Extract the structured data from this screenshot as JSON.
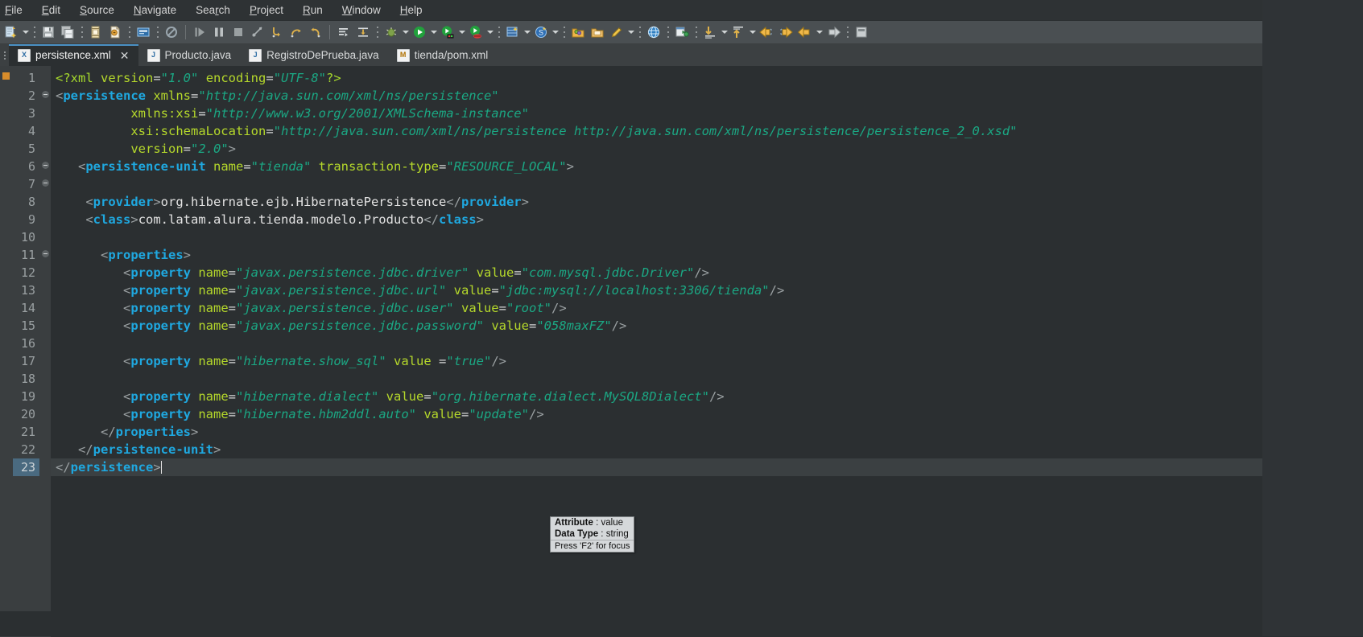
{
  "window": {
    "app": "Eclipse IDE"
  },
  "menubar": {
    "items": [
      {
        "label": "File",
        "mnemonic_index": 0
      },
      {
        "label": "Edit",
        "mnemonic_index": 0
      },
      {
        "label": "Source",
        "mnemonic_index": 0
      },
      {
        "label": "Navigate",
        "mnemonic_index": 0
      },
      {
        "label": "Search",
        "mnemonic_index": 3
      },
      {
        "label": "Project",
        "mnemonic_index": 0
      },
      {
        "label": "Run",
        "mnemonic_index": 0
      },
      {
        "label": "Window",
        "mnemonic_index": 0
      },
      {
        "label": "Help",
        "mnemonic_index": 0
      }
    ]
  },
  "toolbar": {
    "groups": [
      [
        "new-wizard-icon",
        "new-wizard-dropdown"
      ],
      [
        "save-icon",
        "save-all-icon"
      ],
      [
        "new-java-package-icon",
        "new-java-class-icon"
      ],
      [
        "open-task-icon"
      ],
      [
        "skip-all-breakpoints-icon"
      ],
      [
        "resume-icon",
        "suspend-icon",
        "terminate-icon",
        "disconnect-icon",
        "step-into-icon",
        "step-over-icon",
        "step-return-icon"
      ],
      [
        "use-step-filters-icon",
        "drop-to-frame-icon"
      ],
      [
        "debug-icon",
        "debug-dropdown",
        "run-icon",
        "run-dropdown",
        "run-as-server-icon",
        "run-as-server-dropdown",
        "coverage-icon",
        "coverage-dropdown"
      ],
      [
        "new-server-icon",
        "new-server-dropdown",
        "search-icon",
        "search-dropdown"
      ],
      [
        "open-type-icon",
        "open-task-folder-icon",
        "toggle-mark-occurrences-icon",
        "mark-dropdown"
      ],
      [
        "open-web-browser-icon"
      ],
      [
        "open-perspective-icon"
      ],
      [
        "previous-annotation-icon",
        "previous-annotation-dropdown"
      ],
      [
        "next-annotation-icon",
        "next-annotation-dropdown"
      ],
      [
        "back-to-icon",
        "forward-to-icon"
      ],
      [
        "back-navigation-icon",
        "back-navigation-dropdown",
        "forward-navigation-icon"
      ],
      [
        "pin-editor-icon"
      ]
    ]
  },
  "tabs": [
    {
      "label": "persistence.xml",
      "icon": "xml-file-icon",
      "icon_letter": "X",
      "icon_kind": "x",
      "active": true,
      "closeable": true
    },
    {
      "label": "Producto.java",
      "icon": "java-file-icon",
      "icon_letter": "J",
      "icon_kind": "j",
      "active": false,
      "closeable": false
    },
    {
      "label": "RegistroDePrueba.java",
      "icon": "java-file-icon",
      "icon_letter": "J",
      "icon_kind": "j",
      "active": false,
      "closeable": false
    },
    {
      "label": "tienda/pom.xml",
      "icon": "maven-file-icon",
      "icon_letter": "M",
      "icon_kind": "m",
      "active": false,
      "closeable": false
    }
  ],
  "editor": {
    "file": "persistence.xml",
    "current_line": 23,
    "total_lines": 23,
    "lines": [
      {
        "n": 1,
        "fold": false,
        "tokens": [
          {
            "t": "decl",
            "v": "<?xml "
          },
          {
            "t": "attr",
            "v": "version"
          },
          {
            "t": "eq",
            "v": "="
          },
          {
            "t": "val",
            "v": "\"1.0\""
          },
          {
            "t": "txt",
            "v": " "
          },
          {
            "t": "attr",
            "v": "encoding"
          },
          {
            "t": "eq",
            "v": "="
          },
          {
            "t": "val",
            "v": "\"UTF-8\""
          },
          {
            "t": "decl",
            "v": "?>"
          }
        ]
      },
      {
        "n": 2,
        "fold": true,
        "tokens": [
          {
            "t": "brack",
            "v": "<"
          },
          {
            "t": "tag",
            "v": "persistence"
          },
          {
            "t": "txt",
            "v": " "
          },
          {
            "t": "attr",
            "v": "xmlns"
          },
          {
            "t": "eq",
            "v": "="
          },
          {
            "t": "val",
            "v": "\"http://java.sun.com/xml/ns/persistence\""
          }
        ]
      },
      {
        "n": 3,
        "fold": false,
        "tokens": [
          {
            "t": "txt",
            "v": "          "
          },
          {
            "t": "attr",
            "v": "xmlns:xsi"
          },
          {
            "t": "eq",
            "v": "="
          },
          {
            "t": "val",
            "v": "\"http://www.w3.org/2001/XMLSchema-instance\""
          }
        ]
      },
      {
        "n": 4,
        "fold": false,
        "tokens": [
          {
            "t": "txt",
            "v": "          "
          },
          {
            "t": "attr",
            "v": "xsi:schemaLocation"
          },
          {
            "t": "eq",
            "v": "="
          },
          {
            "t": "val",
            "v": "\"http://java.sun.com/xml/ns/persistence http://java.sun.com/xml/ns/persistence/persistence_2_0.xsd\""
          }
        ]
      },
      {
        "n": 5,
        "fold": false,
        "tokens": [
          {
            "t": "txt",
            "v": "          "
          },
          {
            "t": "attr",
            "v": "version"
          },
          {
            "t": "eq",
            "v": "="
          },
          {
            "t": "val",
            "v": "\"2.0\""
          },
          {
            "t": "brack",
            "v": ">"
          }
        ]
      },
      {
        "n": 6,
        "fold": true,
        "tokens": [
          {
            "t": "txt",
            "v": "   "
          },
          {
            "t": "brack",
            "v": "<"
          },
          {
            "t": "tag",
            "v": "persistence-unit"
          },
          {
            "t": "txt",
            "v": " "
          },
          {
            "t": "attr",
            "v": "name"
          },
          {
            "t": "eq",
            "v": "="
          },
          {
            "t": "val",
            "v": "\"tienda\""
          },
          {
            "t": "txt",
            "v": " "
          },
          {
            "t": "attr",
            "v": "transaction-type"
          },
          {
            "t": "eq",
            "v": "="
          },
          {
            "t": "val",
            "v": "\"RESOURCE_LOCAL\""
          },
          {
            "t": "brack",
            "v": ">"
          }
        ]
      },
      {
        "n": 7,
        "fold": true,
        "tokens": []
      },
      {
        "n": 8,
        "fold": false,
        "tokens": [
          {
            "t": "txt",
            "v": "    "
          },
          {
            "t": "brack",
            "v": "<"
          },
          {
            "t": "tag",
            "v": "provider"
          },
          {
            "t": "brack",
            "v": ">"
          },
          {
            "t": "txt",
            "v": "org.hibernate.ejb.HibernatePersistence"
          },
          {
            "t": "brack",
            "v": "</"
          },
          {
            "t": "tag",
            "v": "provider"
          },
          {
            "t": "brack",
            "v": ">"
          }
        ]
      },
      {
        "n": 9,
        "fold": false,
        "tokens": [
          {
            "t": "txt",
            "v": "    "
          },
          {
            "t": "brack",
            "v": "<"
          },
          {
            "t": "tag",
            "v": "class"
          },
          {
            "t": "brack",
            "v": ">"
          },
          {
            "t": "txt",
            "v": "com.latam.alura.tienda.modelo.Producto"
          },
          {
            "t": "brack",
            "v": "</"
          },
          {
            "t": "tag",
            "v": "class"
          },
          {
            "t": "brack",
            "v": ">"
          }
        ]
      },
      {
        "n": 10,
        "fold": false,
        "tokens": []
      },
      {
        "n": 11,
        "fold": true,
        "tokens": [
          {
            "t": "txt",
            "v": "      "
          },
          {
            "t": "brack",
            "v": "<"
          },
          {
            "t": "tag",
            "v": "properties"
          },
          {
            "t": "brack",
            "v": ">"
          }
        ]
      },
      {
        "n": 12,
        "fold": false,
        "tokens": [
          {
            "t": "txt",
            "v": "         "
          },
          {
            "t": "brack",
            "v": "<"
          },
          {
            "t": "tag",
            "v": "property"
          },
          {
            "t": "txt",
            "v": " "
          },
          {
            "t": "attr",
            "v": "name"
          },
          {
            "t": "eq",
            "v": "="
          },
          {
            "t": "val",
            "v": "\"javax.persistence.jdbc.driver\""
          },
          {
            "t": "txt",
            "v": " "
          },
          {
            "t": "attr",
            "v": "value"
          },
          {
            "t": "eq",
            "v": "="
          },
          {
            "t": "val",
            "v": "\"com.mysql.jdbc.Driver\""
          },
          {
            "t": "brack",
            "v": "/>"
          }
        ]
      },
      {
        "n": 13,
        "fold": false,
        "tokens": [
          {
            "t": "txt",
            "v": "         "
          },
          {
            "t": "brack",
            "v": "<"
          },
          {
            "t": "tag",
            "v": "property"
          },
          {
            "t": "txt",
            "v": " "
          },
          {
            "t": "attr",
            "v": "name"
          },
          {
            "t": "eq",
            "v": "="
          },
          {
            "t": "val",
            "v": "\"javax.persistence.jdbc.url\""
          },
          {
            "t": "txt",
            "v": " "
          },
          {
            "t": "attr",
            "v": "value"
          },
          {
            "t": "eq",
            "v": "="
          },
          {
            "t": "val",
            "v": "\"jdbc:mysql://localhost:3306/tienda\""
          },
          {
            "t": "brack",
            "v": "/>"
          }
        ]
      },
      {
        "n": 14,
        "fold": false,
        "tokens": [
          {
            "t": "txt",
            "v": "         "
          },
          {
            "t": "brack",
            "v": "<"
          },
          {
            "t": "tag",
            "v": "property"
          },
          {
            "t": "txt",
            "v": " "
          },
          {
            "t": "attr",
            "v": "name"
          },
          {
            "t": "eq",
            "v": "="
          },
          {
            "t": "val",
            "v": "\"javax.persistence.jdbc.user\""
          },
          {
            "t": "txt",
            "v": " "
          },
          {
            "t": "attr",
            "v": "value"
          },
          {
            "t": "eq",
            "v": "="
          },
          {
            "t": "val",
            "v": "\"root\""
          },
          {
            "t": "brack",
            "v": "/>"
          }
        ]
      },
      {
        "n": 15,
        "fold": false,
        "tokens": [
          {
            "t": "txt",
            "v": "         "
          },
          {
            "t": "brack",
            "v": "<"
          },
          {
            "t": "tag",
            "v": "property"
          },
          {
            "t": "txt",
            "v": " "
          },
          {
            "t": "attr",
            "v": "name"
          },
          {
            "t": "eq",
            "v": "="
          },
          {
            "t": "val",
            "v": "\"javax.persistence.jdbc.password\""
          },
          {
            "t": "txt",
            "v": " "
          },
          {
            "t": "attr",
            "v": "value"
          },
          {
            "t": "eq",
            "v": "="
          },
          {
            "t": "val",
            "v": "\"058maxFZ\""
          },
          {
            "t": "brack",
            "v": "/>"
          }
        ]
      },
      {
        "n": 16,
        "fold": false,
        "tokens": []
      },
      {
        "n": 17,
        "fold": false,
        "tokens": [
          {
            "t": "txt",
            "v": "         "
          },
          {
            "t": "brack",
            "v": "<"
          },
          {
            "t": "tag",
            "v": "property"
          },
          {
            "t": "txt",
            "v": " "
          },
          {
            "t": "attr",
            "v": "name"
          },
          {
            "t": "eq",
            "v": "="
          },
          {
            "t": "val",
            "v": "\"hibernate.show_sql\""
          },
          {
            "t": "txt",
            "v": " "
          },
          {
            "t": "attr",
            "v": "value "
          },
          {
            "t": "eq",
            "v": "="
          },
          {
            "t": "val",
            "v": "\"true\""
          },
          {
            "t": "brack",
            "v": "/>"
          }
        ]
      },
      {
        "n": 18,
        "fold": false,
        "tokens": []
      },
      {
        "n": 19,
        "fold": false,
        "tokens": [
          {
            "t": "txt",
            "v": "         "
          },
          {
            "t": "brack",
            "v": "<"
          },
          {
            "t": "tag",
            "v": "property"
          },
          {
            "t": "txt",
            "v": " "
          },
          {
            "t": "attr",
            "v": "name"
          },
          {
            "t": "eq",
            "v": "="
          },
          {
            "t": "val",
            "v": "\"hibernate.dialect\""
          },
          {
            "t": "txt",
            "v": " "
          },
          {
            "t": "attr",
            "v": "value"
          },
          {
            "t": "eq",
            "v": "="
          },
          {
            "t": "val",
            "v": "\"org.hibernate.dialect.MySQL8Dialect\""
          },
          {
            "t": "brack",
            "v": "/>"
          }
        ]
      },
      {
        "n": 20,
        "fold": false,
        "tokens": [
          {
            "t": "txt",
            "v": "         "
          },
          {
            "t": "brack",
            "v": "<"
          },
          {
            "t": "tag",
            "v": "property"
          },
          {
            "t": "txt",
            "v": " "
          },
          {
            "t": "attr",
            "v": "name"
          },
          {
            "t": "eq",
            "v": "="
          },
          {
            "t": "val",
            "v": "\"hibernate.hbm2ddl.auto\""
          },
          {
            "t": "txt",
            "v": " "
          },
          {
            "t": "attr",
            "v": "value"
          },
          {
            "t": "eq",
            "v": "="
          },
          {
            "t": "val",
            "v": "\"update\""
          },
          {
            "t": "brack",
            "v": "/>"
          }
        ]
      },
      {
        "n": 21,
        "fold": false,
        "tokens": [
          {
            "t": "txt",
            "v": "      "
          },
          {
            "t": "brack",
            "v": "</"
          },
          {
            "t": "tag",
            "v": "properties"
          },
          {
            "t": "brack",
            "v": ">"
          }
        ]
      },
      {
        "n": 22,
        "fold": false,
        "tokens": [
          {
            "t": "txt",
            "v": "   "
          },
          {
            "t": "brack",
            "v": "</"
          },
          {
            "t": "tag",
            "v": "persistence-unit"
          },
          {
            "t": "brack",
            "v": ">"
          }
        ]
      },
      {
        "n": 23,
        "fold": false,
        "current": true,
        "caret": true,
        "tokens": [
          {
            "t": "brack",
            "v": "</"
          },
          {
            "t": "tag",
            "v": "persistence"
          },
          {
            "t": "brack",
            "v": ">"
          }
        ]
      }
    ]
  },
  "tooltip": {
    "rows": [
      {
        "label": "Attribute",
        "sep": " : ",
        "value": "value"
      },
      {
        "label": "Data Type",
        "sep": " : ",
        "value": "string"
      }
    ],
    "footer": "Press 'F2' for focus"
  },
  "colors": {
    "editor_bg": "#2b2f31",
    "gutter_bg": "#3a3e40",
    "tag": "#1fa8e0",
    "attribute": "#b5d82b",
    "value": "#1ba884",
    "declaration": "#a6d92c",
    "text": "#e3e3e3",
    "current_line": "#3b4042",
    "tab_active_underline": "#4a90c4"
  }
}
